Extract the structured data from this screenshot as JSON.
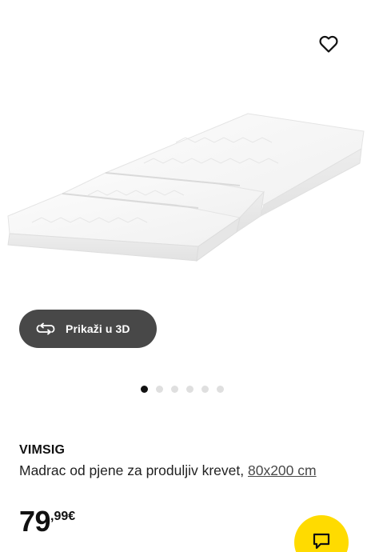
{
  "product": {
    "name": "VIMSIG",
    "description_text": "Madrac od pjene za produljiv krevet, ",
    "size_link": "80x200 cm",
    "price_integer": "79",
    "price_decimal": ",99€"
  },
  "viewer": {
    "view_3d_label": "Prikaži u 3D"
  },
  "carousel": {
    "total_images": 6,
    "active_index": 0
  },
  "colors": {
    "chat_button": "#ffdb00",
    "view_3d_button": "#484848",
    "active_dot": "#111111",
    "inactive_dot": "#dfdfdf"
  },
  "icons": {
    "wishlist": "heart-outline-icon",
    "view_3d": "rotate-360-icon",
    "chat": "chat-bubble-icon"
  }
}
